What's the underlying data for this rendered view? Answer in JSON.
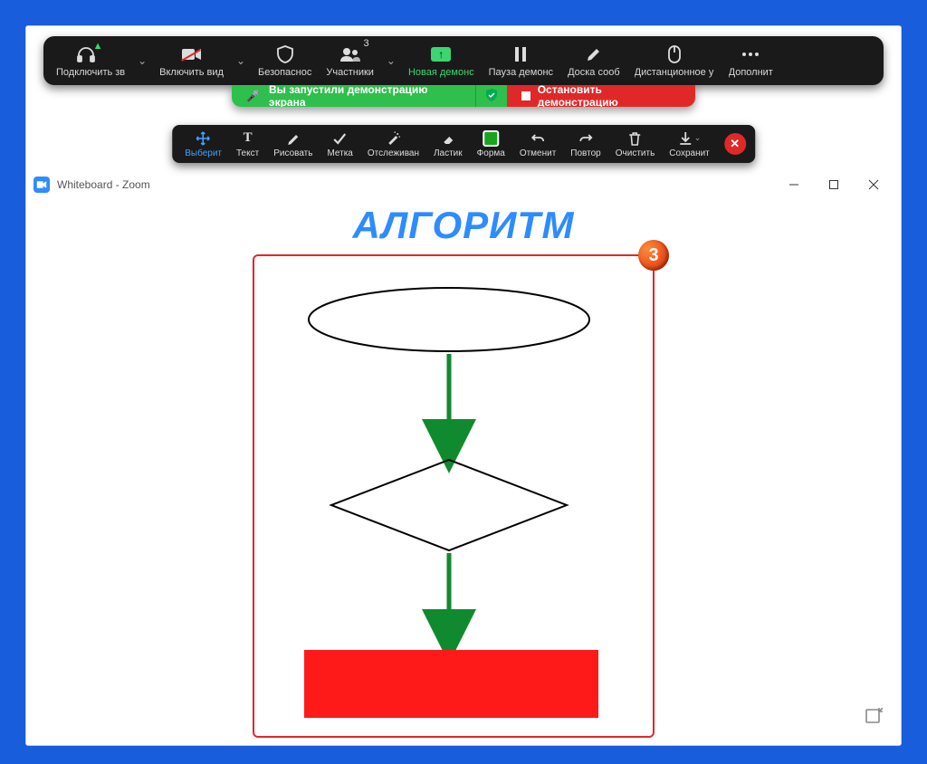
{
  "zoomBar": {
    "audio": {
      "label": "Подключить зв",
      "icon": "headphones-up-icon"
    },
    "video": {
      "label": "Включить вид",
      "icon": "video-off-icon"
    },
    "security": {
      "label": "Безопаснос",
      "icon": "shield-icon"
    },
    "participants": {
      "label": "Участники",
      "icon": "participants-icon",
      "count": "3"
    },
    "newShare": {
      "label": "Новая демонс",
      "icon": "share-screen-up-icon"
    },
    "pause": {
      "label": "Пауза демонс",
      "icon": "pause-icon"
    },
    "annotate": {
      "label": "Доска сооб",
      "icon": "pencil-icon"
    },
    "remote": {
      "label": "Дистанционное уп",
      "icon": "mouse-icon"
    },
    "more": {
      "label": "Дополнит",
      "icon": "more-icon"
    }
  },
  "shareBanner": {
    "status": "Вы запустили демонстрацию экрана",
    "stop": "Остановить демонстрацию"
  },
  "annoBar": {
    "select": "Выберит",
    "text": "Текст",
    "draw": "Рисовать",
    "stamp": "Метка",
    "spotlight": "Отслеживан",
    "eraser": "Ластик",
    "format": "Форма",
    "undo": "Отменит",
    "redo": "Повтор",
    "clear": "Очистить",
    "save": "Сохранит"
  },
  "whiteboard": {
    "windowTitle": "Whiteboard - Zoom",
    "heading": "АЛГОРИТМ"
  },
  "callout": {
    "number": "3"
  },
  "colors": {
    "accent": "#2d8cff",
    "arrow": "#108a2e",
    "rect": "#ff1a1a",
    "selectFrame": "#e02828"
  }
}
